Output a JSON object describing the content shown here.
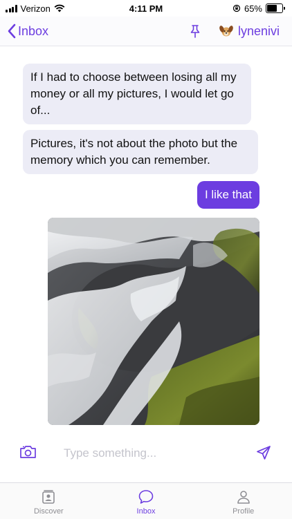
{
  "status_bar": {
    "carrier": "Verizon",
    "time": "4:11 PM",
    "battery": "65%",
    "battery_level": 0.65
  },
  "header": {
    "back_label": "Inbox",
    "username": "lynenivi",
    "avatar_icon": "dog-face-icon",
    "pin_icon": "pin-icon"
  },
  "messages": [
    {
      "direction": "incoming",
      "text": "If I had to choose between losing all my money or all my pictures, I would let go of..."
    },
    {
      "direction": "incoming",
      "text": "Pictures, it's not about the photo but the memory which you can remember."
    },
    {
      "direction": "outgoing",
      "text": "I like that"
    },
    {
      "direction": "outgoing",
      "type": "image",
      "subject": "waterfall"
    }
  ],
  "composer": {
    "placeholder": "Type something...",
    "value": "",
    "camera_icon": "camera-icon",
    "send_icon": "send-icon"
  },
  "tabs": [
    {
      "label": "Discover",
      "icon": "discover-icon",
      "active": false
    },
    {
      "label": "Inbox",
      "icon": "chat-bubble-icon",
      "active": true
    },
    {
      "label": "Profile",
      "icon": "person-icon",
      "active": false
    }
  ],
  "colors": {
    "accent": "#6c3de0",
    "incoming_bubble": "#ececf6",
    "tab_inactive": "#8e8e93"
  }
}
